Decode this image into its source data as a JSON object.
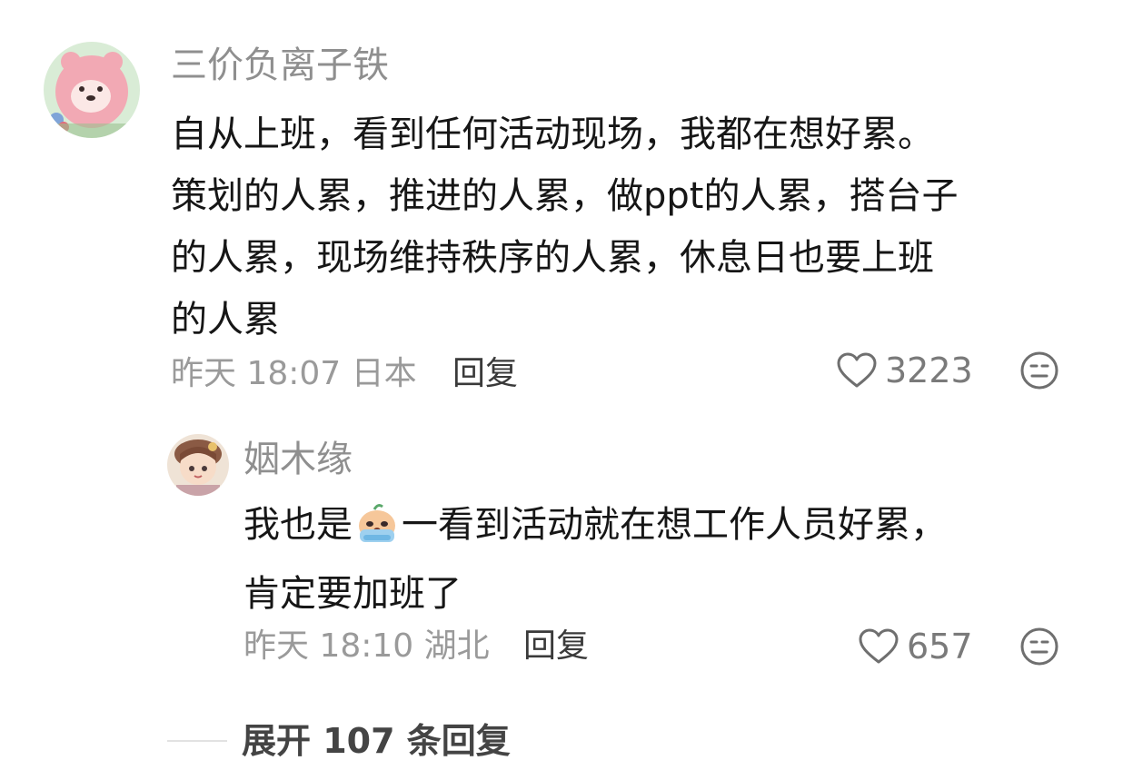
{
  "comment": {
    "username": "三价负离子铁",
    "text_lines": [
      "自从上班，看到任何活动现场，我都在想好累。",
      "策划的人累，推进的人累，做ppt的人累，搭台子",
      "的人累，现场维持秩序的人累，休息日也要上班",
      "的人累"
    ],
    "time": "昨天 18:07",
    "location": "日本",
    "reply_label": "回复",
    "like_count": "3223",
    "avatar_icon": "pink-bear-avatar",
    "like_icon": "heart-outline-icon",
    "dislike_icon": "dislike-face-icon"
  },
  "reply": {
    "username": "姻木缘",
    "text_before_emoji": "我也是",
    "emoji_icon": "crying-face-emoji",
    "text_after_emoji": "一看到活动就在想工作人员好累，",
    "text_line2": "肯定要加班了",
    "time": "昨天 18:10",
    "location": "湖北",
    "reply_label": "回复",
    "like_count": "657",
    "avatar_icon": "anime-girl-avatar",
    "like_icon": "heart-outline-icon",
    "dislike_icon": "dislike-face-icon"
  },
  "expand": {
    "label": "展开 107 条回复"
  },
  "colors": {
    "username": "#8f8f8f",
    "text": "#161616",
    "meta": "#9a9a9a",
    "icon": "#6f6f6f"
  }
}
